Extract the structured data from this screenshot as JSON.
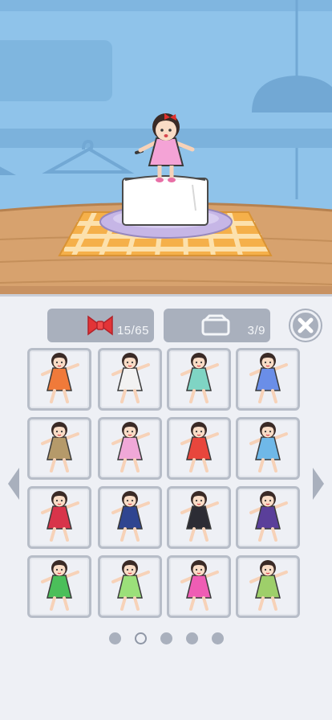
{
  "scene": {
    "character": "girl-in-pink-dress",
    "pedestal": "tofu-block",
    "mat": "orange-checkered-cloth"
  },
  "counters": {
    "costumes": {
      "icon": "ribbon-icon",
      "value": "15/65"
    },
    "boxes": {
      "icon": "box-icon",
      "value": "3/9"
    }
  },
  "close_icon": "close-icon",
  "costumes": [
    {
      "name": "orange-flower-dress",
      "color": "#f07a3a",
      "locked": false
    },
    {
      "name": "ghost-white-robe",
      "color": "#f2f2f2",
      "locked": false
    },
    {
      "name": "mint-striped-dress",
      "color": "#7fd4c4",
      "locked": false
    },
    {
      "name": "cheerleader",
      "color": "#6a8ee8",
      "locked": false
    },
    {
      "name": "tribal-spear",
      "color": "#b59a6a",
      "locked": false
    },
    {
      "name": "pink-bunny-suit",
      "color": "#f0a8d8",
      "locked": false
    },
    {
      "name": "basketball-player",
      "color": "#e8463c",
      "locked": false
    },
    {
      "name": "tennis-player",
      "color": "#6fb8e8",
      "locked": false
    },
    {
      "name": "shrine-maiden",
      "color": "#d8344a",
      "locked": false
    },
    {
      "name": "police-officer",
      "color": "#2f4590",
      "locked": false
    },
    {
      "name": "business-suit",
      "color": "#2c2c34",
      "locked": false
    },
    {
      "name": "jiangshi",
      "color": "#5a3f9a",
      "locked": false
    },
    {
      "name": "hula-dancer",
      "color": "#4bbf5a",
      "locked": false
    },
    {
      "name": "green-fairy",
      "color": "#9be07a",
      "locked": false
    },
    {
      "name": "pop-idol",
      "color": "#ef5db4",
      "locked": false
    },
    {
      "name": "heian-princess",
      "color": "#9ecf6a",
      "locked": false
    }
  ],
  "pagination": {
    "pages": 5,
    "current": 2
  }
}
